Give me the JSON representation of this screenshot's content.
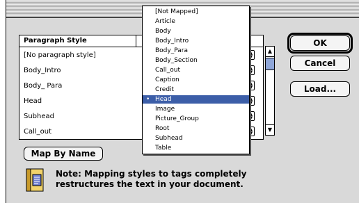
{
  "table": {
    "header": "Paragraph Style",
    "rows": [
      {
        "label": "[No paragraph style]"
      },
      {
        "label": "Body_Intro"
      },
      {
        "label": "Body_ Para"
      },
      {
        "label": "Head"
      },
      {
        "label": "Subhead"
      },
      {
        "label": "Call_out"
      }
    ]
  },
  "buttons": {
    "ok": "OK",
    "cancel": "Cancel",
    "load": "Load...",
    "map_by_name": "Map By Name"
  },
  "note": {
    "line1": "Note: Mapping styles to tags completely",
    "line2": "restructures the text in your document."
  },
  "popup_menu": {
    "items": [
      {
        "label": "[Not Mapped]"
      },
      {
        "label": "Article"
      },
      {
        "label": "Body"
      },
      {
        "label": "Body_Intro"
      },
      {
        "label": "Body_Para"
      },
      {
        "label": "Body_Section"
      },
      {
        "label": "Call_out"
      },
      {
        "label": "Caption"
      },
      {
        "label": "Credit"
      },
      {
        "label": "Head"
      },
      {
        "label": "Image"
      },
      {
        "label": "Picture_Group"
      },
      {
        "label": "Root"
      },
      {
        "label": "Subhead"
      },
      {
        "label": "Table"
      }
    ],
    "selected_index": 9,
    "bullet": "•"
  },
  "icons": {
    "stepper": "up-down-arrows-icon",
    "scroll_up": "scroll-up-arrow-icon",
    "scroll_down": "scroll-down-arrow-icon",
    "note": "document-note-icon"
  },
  "colors": {
    "dialog_bg": "#d9d9d9",
    "selection": "#3c5ea8",
    "scroll_thumb": "#8fa6d8"
  }
}
